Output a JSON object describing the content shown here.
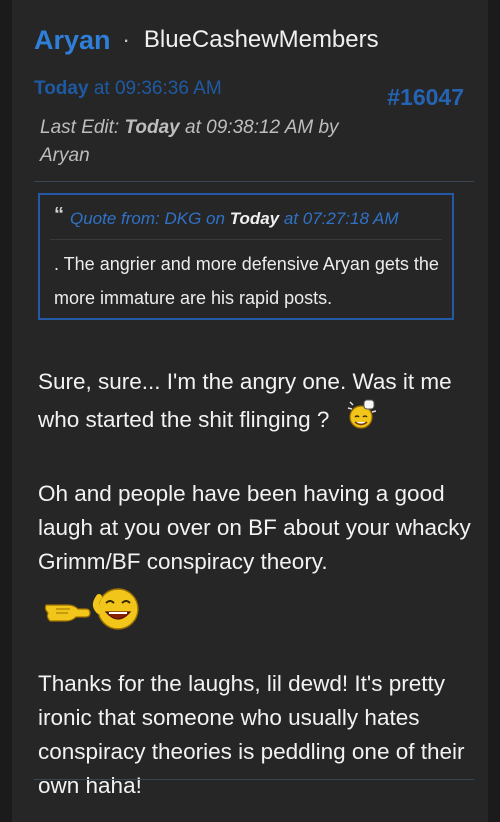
{
  "post": {
    "author": "Aryan",
    "separator": "·",
    "group": "BlueCashewMembers",
    "date_word": "Today",
    "time": "at 09:36:36 AM",
    "number": "#16047",
    "last_edit": {
      "label": "Last Edit:",
      "day": "Today",
      "time_by": "at 09:38:12 AM by",
      "editor": "Aryan"
    }
  },
  "quote": {
    "mark": "“",
    "from_prefix": "Quote from: DKG on",
    "day": "Today",
    "time": "at 07:27:18 AM",
    "body": ". The angrier and more defensive Aryan gets the more immature are his rapid posts."
  },
  "content": {
    "para1": "Sure, sure... I'm the angry one. Was it me who started the shit flinging ?",
    "para2": "Oh and people have been having a good laugh at you over on BF about your whacky Grimm/BF conspiracy theory.",
    "para3": "Thanks for the laughs, lil dewd! It's pretty ironic that someone who usually hates conspiracy theories is peddling one of their own haha!"
  },
  "icons": {
    "smiley1": "waving-fist-smiley-icon",
    "smiley2": "pointing-laughing-smiley-icon"
  }
}
